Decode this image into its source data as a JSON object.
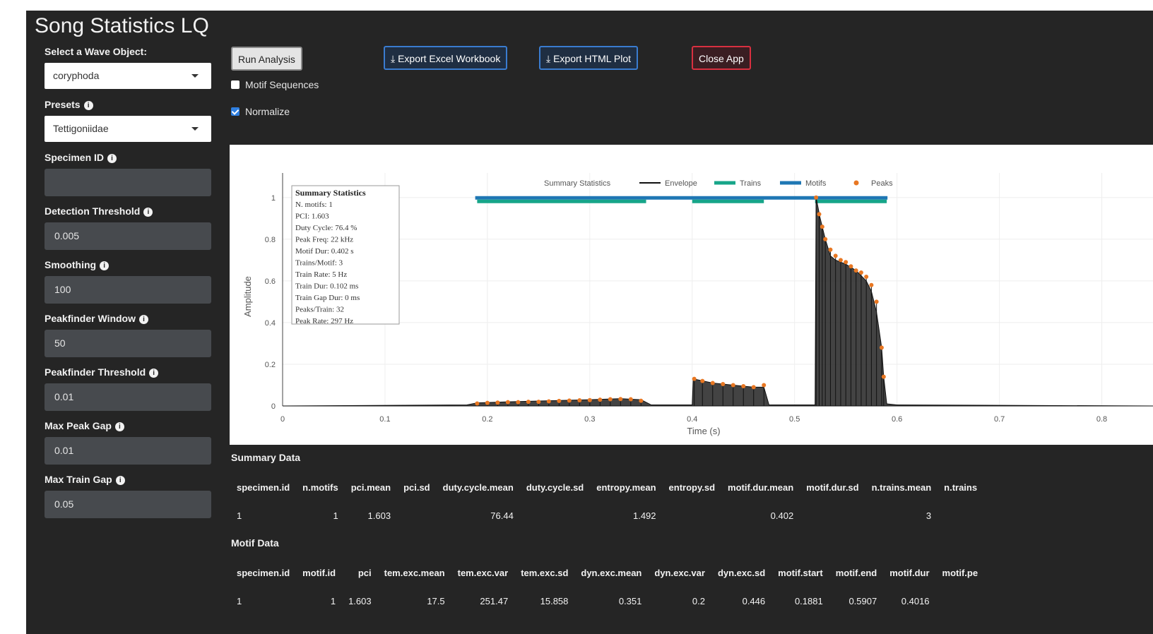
{
  "app": {
    "title": "Song Statistics LQ"
  },
  "sidebar": {
    "wave_label": "Select a Wave Object:",
    "wave_value": "coryphoda",
    "presets_label": "Presets",
    "presets_value": "Tettigoniidae",
    "specimen_label": "Specimen ID",
    "specimen_value": "",
    "detection_label": "Detection Threshold",
    "detection_value": "0.005",
    "smoothing_label": "Smoothing",
    "smoothing_value": "100",
    "pf_window_label": "Peakfinder Window",
    "pf_window_value": "50",
    "pf_threshold_label": "Peakfinder Threshold",
    "pf_threshold_value": "0.01",
    "max_peak_gap_label": "Max Peak Gap",
    "max_peak_gap_value": "0.01",
    "max_train_gap_label": "Max Train Gap",
    "max_train_gap_value": "0.05"
  },
  "toolbar": {
    "run_label": "Run Analysis",
    "export_excel_label": "Export Excel Workbook",
    "export_html_label": "Export HTML Plot",
    "close_label": "Close App",
    "motif_seq_label": "Motif Sequences",
    "motif_seq_checked": false,
    "normalize_label": "Normalize",
    "normalize_checked": true
  },
  "summary_box": {
    "title": "Summary Statistics",
    "lines": [
      "N. motifs: 1",
      "PCI: 1.603",
      "Duty Cycle: 76.4 %",
      "Peak Freq: 22 kHz",
      "Motif Dur: 0.402 s",
      "Trains/Motif: 3",
      "Train Rate: 5 Hz",
      "Train Dur: 0.102 ms",
      "Train Gap Dur: 0 ms",
      "Peaks/Train: 32",
      "Peak Rate: 297 Hz"
    ]
  },
  "chart_data": {
    "type": "line",
    "xlabel": "Time (s)",
    "ylabel": "Amplitude",
    "xlim": [
      0,
      0.85
    ],
    "ylim": [
      0,
      1.05
    ],
    "x_ticks": [
      "0",
      "0.1",
      "0.2",
      "0.3",
      "0.4",
      "0.5",
      "0.6",
      "0.7",
      "0.8"
    ],
    "y_ticks": [
      "0",
      "0.2",
      "0.4",
      "0.6",
      "0.8",
      "1"
    ],
    "grid": true,
    "legend": {
      "title": "Summary Statistics",
      "placement": "top-center",
      "items": [
        "Envelope",
        "Trains",
        "Motifs",
        "Peaks"
      ]
    },
    "colors": {
      "envelope": "#111111",
      "trains": "#17a589",
      "motifs": "#1f77b4",
      "peaks": "#e87722"
    },
    "motifs": [
      {
        "start": 0.1881,
        "end": 0.5907
      }
    ],
    "trains": [
      {
        "start": 0.19,
        "end": 0.355
      },
      {
        "start": 0.4,
        "end": 0.47
      },
      {
        "start": 0.52,
        "end": 0.59
      }
    ],
    "envelope": {
      "x": [
        0,
        0.18,
        0.19,
        0.22,
        0.26,
        0.3,
        0.33,
        0.35,
        0.36,
        0.4,
        0.401,
        0.42,
        0.44,
        0.46,
        0.47,
        0.475,
        0.52,
        0.521,
        0.525,
        0.53,
        0.535,
        0.54,
        0.55,
        0.56,
        0.57,
        0.575,
        0.58,
        0.585,
        0.587,
        0.59,
        0.6,
        0.85
      ],
      "y": [
        0,
        0.005,
        0.015,
        0.02,
        0.025,
        0.03,
        0.035,
        0.03,
        0.005,
        0.005,
        0.13,
        0.11,
        0.1,
        0.09,
        0.09,
        0.005,
        0.005,
        1.0,
        0.9,
        0.8,
        0.72,
        0.7,
        0.68,
        0.65,
        0.6,
        0.55,
        0.45,
        0.28,
        0.14,
        0.01,
        0.005,
        0
      ]
    },
    "peaks": {
      "x": [
        0.19,
        0.2,
        0.21,
        0.22,
        0.23,
        0.24,
        0.25,
        0.26,
        0.27,
        0.28,
        0.29,
        0.3,
        0.31,
        0.32,
        0.33,
        0.34,
        0.35,
        0.402,
        0.41,
        0.42,
        0.43,
        0.44,
        0.45,
        0.46,
        0.47,
        0.521,
        0.524,
        0.527,
        0.53,
        0.535,
        0.54,
        0.545,
        0.55,
        0.555,
        0.56,
        0.565,
        0.57,
        0.575,
        0.58,
        0.585,
        0.587
      ],
      "y": [
        0.012,
        0.015,
        0.016,
        0.018,
        0.018,
        0.02,
        0.02,
        0.022,
        0.024,
        0.026,
        0.027,
        0.028,
        0.03,
        0.032,
        0.033,
        0.032,
        0.025,
        0.13,
        0.12,
        0.11,
        0.105,
        0.1,
        0.095,
        0.09,
        0.1,
        1.0,
        0.92,
        0.86,
        0.8,
        0.75,
        0.72,
        0.7,
        0.69,
        0.67,
        0.65,
        0.64,
        0.62,
        0.58,
        0.5,
        0.28,
        0.14
      ]
    }
  },
  "summary_section": {
    "title": "Summary Data"
  },
  "summary_table": {
    "columns": [
      "specimen.id",
      "n.motifs",
      "pci.mean",
      "pci.sd",
      "duty.cycle.mean",
      "duty.cycle.sd",
      "entropy.mean",
      "entropy.sd",
      "motif.dur.mean",
      "motif.dur.sd",
      "n.trains.mean",
      "n.trains"
    ],
    "rows": [
      [
        "1",
        "1",
        "1.603",
        "",
        "76.44",
        "",
        "1.492",
        "",
        "0.402",
        "",
        "3",
        ""
      ]
    ]
  },
  "motif_section": {
    "title": "Motif Data"
  },
  "motif_table": {
    "columns": [
      "specimen.id",
      "motif.id",
      "pci",
      "tem.exc.mean",
      "tem.exc.var",
      "tem.exc.sd",
      "dyn.exc.mean",
      "dyn.exc.var",
      "dyn.exc.sd",
      "motif.start",
      "motif.end",
      "motif.dur",
      "motif.pe"
    ],
    "rows": [
      [
        "1",
        "1",
        "1.603",
        "17.5",
        "251.47",
        "15.858",
        "0.351",
        "0.2",
        "0.446",
        "0.1881",
        "0.5907",
        "0.4016",
        ""
      ]
    ]
  }
}
